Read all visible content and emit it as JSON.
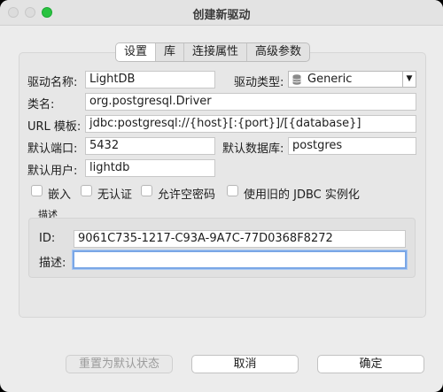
{
  "window": {
    "title": "创建新驱动"
  },
  "tabs": [
    {
      "label": "设置"
    },
    {
      "label": "库"
    },
    {
      "label": "连接属性"
    },
    {
      "label": "高级参数"
    }
  ],
  "settings": {
    "driver_name_label": "驱动名称:",
    "driver_name_value": "LightDB",
    "driver_type_label": "驱动类型:",
    "driver_type_value": "Generic",
    "class_name_label": "类名:",
    "class_name_value": "org.postgresql.Driver",
    "url_template_label": "URL 模板:",
    "url_template_value": "jdbc:postgresql://{host}[:{port}]/[{database}]",
    "default_port_label": "默认端口:",
    "default_port_value": "5432",
    "default_database_label": "默认数据库:",
    "default_database_value": "postgres",
    "default_user_label": "默认用户:",
    "default_user_value": "lightdb"
  },
  "options": {
    "embedded": "嵌入",
    "no_auth": "无认证",
    "allow_empty_password": "允许空密码",
    "legacy_jdbc": "使用旧的 JDBC 实例化"
  },
  "description": {
    "section_label": "描述",
    "id_label": "ID:",
    "id_value": "9061C735-1217-C93A-9A7C-77D0368F8272",
    "desc_label": "描述:",
    "desc_value": ""
  },
  "footer": {
    "reset_label": "重置为默认状态",
    "cancel_label": "取消",
    "ok_label": "确定"
  }
}
